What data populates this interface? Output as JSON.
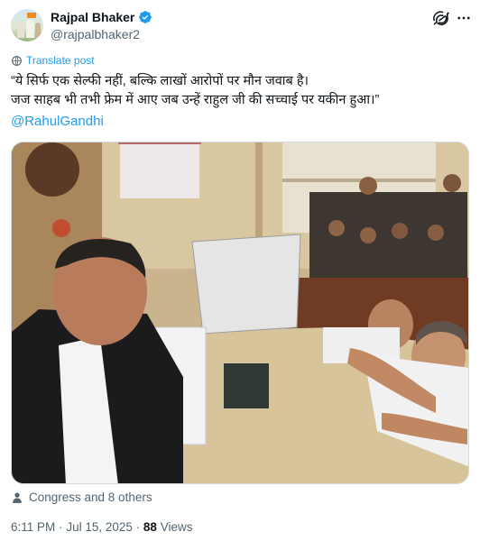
{
  "author": {
    "display_name": "Rajpal Bhaker",
    "handle": "@rajpalbhaker2",
    "verified": true,
    "verified_color": "#1d9bf0"
  },
  "header_actions": [
    "grok-icon",
    "more-icon"
  ],
  "translate": {
    "label": "Translate post",
    "icon": "globe-icon"
  },
  "tweet": {
    "lines": [
      "“ये सिर्फ एक सेल्फी नहीं, बल्कि लाखों आरोपों पर मौन जवाब है।",
      "जज साहब भी तभी फ्रेम में आए जब उन्हें राहुल जी की सच्चाई पर यकीन हुआ।”"
    ],
    "mention": "@RahulGandhi"
  },
  "media": {
    "type": "photo",
    "alt": ""
  },
  "liked_by": {
    "icon": "person-icon",
    "label": "Congress and 8 others"
  },
  "meta": {
    "time": "6:11 PM",
    "separator": "·",
    "date": "Jul 15, 2025",
    "views": "88",
    "views_label": "Views"
  },
  "colors": {
    "text": "#0f1419",
    "secondary": "#536471",
    "accent": "#1d9bf0",
    "border": "#cfd9de"
  }
}
